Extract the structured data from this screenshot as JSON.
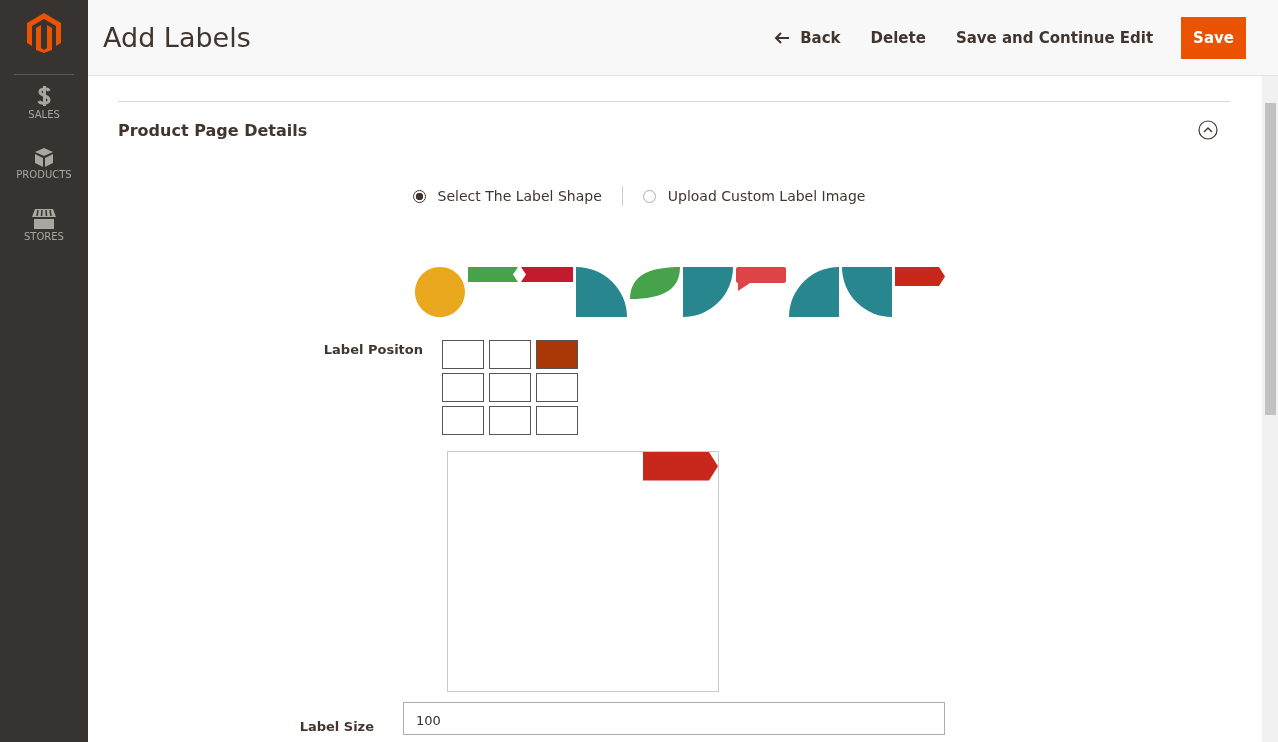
{
  "sidebar": {
    "items": [
      {
        "kind": "dollar",
        "label": "SALES"
      },
      {
        "kind": "box",
        "label": "PRODUCTS"
      },
      {
        "kind": "store",
        "label": "STORES"
      }
    ]
  },
  "header": {
    "title": "Add Labels",
    "buttons": [
      {
        "kind": "back",
        "label": "Back"
      },
      {
        "kind": "plain",
        "label": "Delete"
      },
      {
        "kind": "plain",
        "label": "Save and Continue Edit"
      },
      {
        "kind": "primary",
        "label": "Save"
      }
    ]
  },
  "sections": [
    {
      "title": "Product Page Details",
      "expanded": true
    }
  ],
  "label_source": [
    {
      "label": "Select The Label Shape",
      "selected": true
    },
    {
      "label": "Upload Custom Label Image",
      "selected": false
    }
  ],
  "shapes": [
    {
      "kind": "circle",
      "color": "#eaa81f"
    },
    {
      "kind": "ribbon-right",
      "color": "#46a34c"
    },
    {
      "kind": "ribbon-left",
      "color": "#c21a2e"
    },
    {
      "kind": "quarter-bl",
      "color": "#27868e"
    },
    {
      "kind": "leaf",
      "color": "#46a34c"
    },
    {
      "kind": "quarter-tl",
      "color": "#27868e"
    },
    {
      "kind": "tag-tail",
      "color": "#de4346"
    },
    {
      "kind": "quarter-br",
      "color": "#27868e"
    },
    {
      "kind": "quarter-tr",
      "color": "#27868e"
    },
    {
      "kind": "arrow-tag",
      "color": "#c8281b"
    }
  ],
  "label_position": {
    "label": "Label Positon",
    "cells": [
      {
        "selected": false
      },
      {
        "selected": false
      },
      {
        "selected": true
      },
      {
        "selected": false
      },
      {
        "selected": false
      },
      {
        "selected": false
      },
      {
        "selected": false
      },
      {
        "selected": false
      },
      {
        "selected": false
      }
    ]
  },
  "preview": {
    "color": "#c8281b"
  },
  "label_size": {
    "label": "Label Size",
    "value": "100"
  }
}
